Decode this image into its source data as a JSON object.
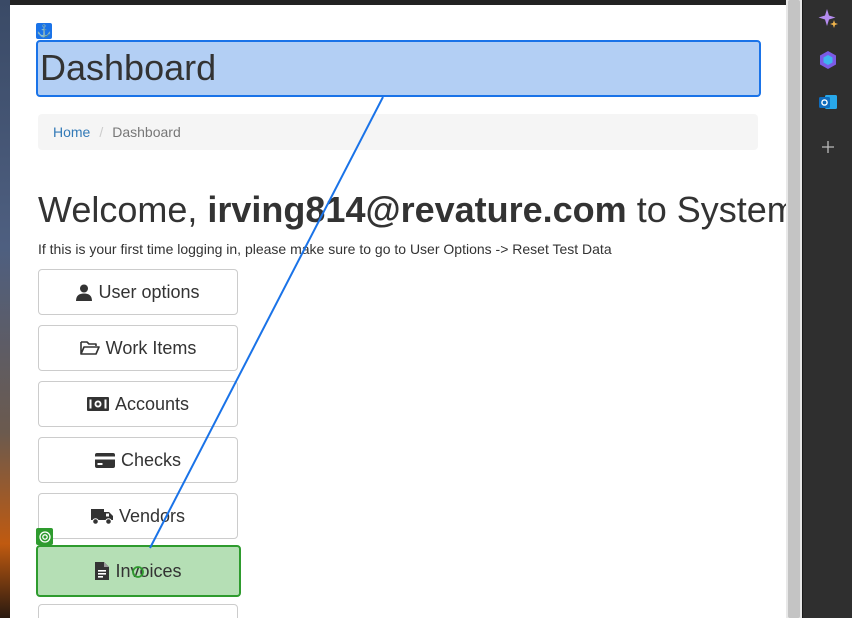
{
  "header": {
    "title": "Dashboard"
  },
  "breadcrumb": {
    "home": "Home",
    "separator": "/",
    "current": "Dashboard"
  },
  "welcome": {
    "prefix": "Welcome, ",
    "user": "irving814@revature.com",
    "suffix": " to System"
  },
  "hint": "If this is your first time logging in, please make sure to go to User Options -> Reset Test Data",
  "menu": [
    {
      "label": "User options",
      "icon": "user-icon"
    },
    {
      "label": "Work Items",
      "icon": "folder-open-icon"
    },
    {
      "label": "Accounts",
      "icon": "money-bill-icon"
    },
    {
      "label": "Checks",
      "icon": "credit-card-icon"
    },
    {
      "label": "Vendors",
      "icon": "truck-icon"
    },
    {
      "label": "Invoices",
      "icon": "file-invoice-icon"
    }
  ],
  "side_panel": {
    "icons": [
      "copilot-sparkle-icon",
      "copilot-hexagon-icon",
      "outlook-icon",
      "add-icon"
    ]
  },
  "colors": {
    "highlight_blue": "#b3cff4",
    "highlight_blue_border": "#1a73e8",
    "highlight_green": "#b5dfb5",
    "highlight_green_border": "#2e9b2e",
    "link": "#337ab7"
  }
}
